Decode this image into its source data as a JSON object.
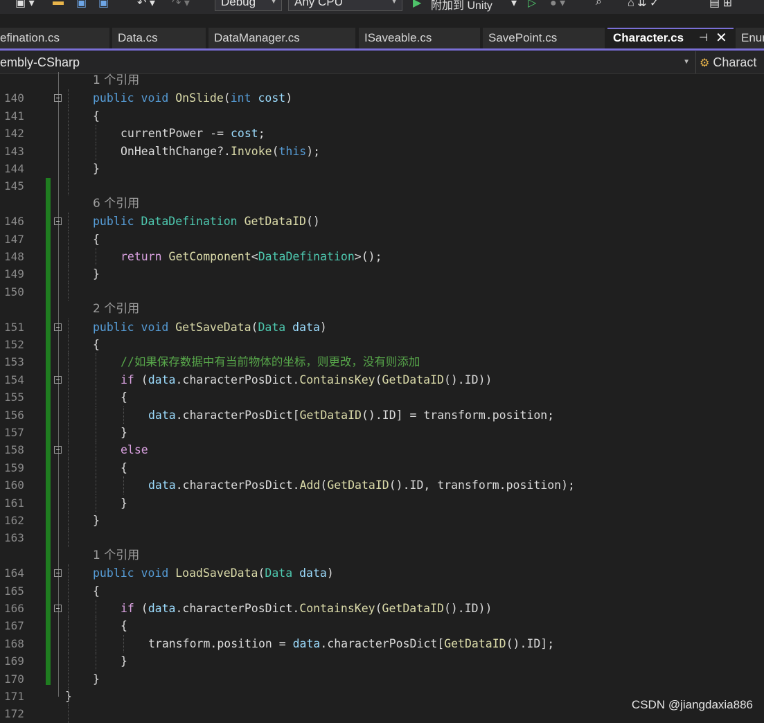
{
  "toolbar": {
    "config": "Debug",
    "platform": "Any CPU",
    "run_label": "附加到 Unity"
  },
  "tabs": [
    {
      "label": "efination.cs"
    },
    {
      "label": "Data.cs"
    },
    {
      "label": "DataManager.cs"
    },
    {
      "label": "ISaveable.cs"
    },
    {
      "label": "SavePoint.cs"
    },
    {
      "label": "Character.cs",
      "active": true
    },
    {
      "label": "Enum"
    }
  ],
  "nav": {
    "project": "embly-CSharp",
    "member": "Charact"
  },
  "colors": {
    "background": "#1f1f1f",
    "keyword": "#569cd6",
    "control": "#d8a0df",
    "type": "#4ec9b0",
    "method": "#dcdcaa",
    "param": "#9cdcfe",
    "comment": "#57a64a",
    "accent": "#7a6fd6",
    "changebar": "#1f7d20"
  },
  "code": {
    "lines": [
      {
        "ref": "1 个引用"
      },
      {
        "n": "140",
        "indent": 0,
        "fold": true,
        "t": [
          [
            "kw",
            "public"
          ],
          [
            "pl",
            " "
          ],
          [
            "kw",
            "void"
          ],
          [
            "pl",
            " "
          ],
          [
            "fn",
            "OnSlide"
          ],
          [
            "pl",
            "("
          ],
          [
            "kw",
            "int"
          ],
          [
            "pl",
            " "
          ],
          [
            "pm",
            "cost"
          ],
          [
            "pl",
            ")"
          ]
        ]
      },
      {
        "n": "141",
        "indent": 0,
        "t": [
          [
            "pl",
            "{"
          ]
        ]
      },
      {
        "n": "142",
        "indent": 1,
        "t": [
          [
            "pl",
            "currentPower -= "
          ],
          [
            "pm",
            "cost"
          ],
          [
            "pl",
            ";"
          ]
        ]
      },
      {
        "n": "143",
        "indent": 1,
        "t": [
          [
            "pl",
            "OnHealthChange?."
          ],
          [
            "fn",
            "Invoke"
          ],
          [
            "pl",
            "("
          ],
          [
            "kw",
            "this"
          ],
          [
            "pl",
            ");"
          ]
        ]
      },
      {
        "n": "144",
        "indent": 0,
        "t": [
          [
            "pl",
            "}"
          ]
        ]
      },
      {
        "n": "145",
        "indent": 0,
        "t": []
      },
      {
        "ref": "6 个引用"
      },
      {
        "n": "146",
        "indent": 0,
        "fold": true,
        "t": [
          [
            "kw",
            "public"
          ],
          [
            "pl",
            " "
          ],
          [
            "ty",
            "DataDefination"
          ],
          [
            "pl",
            " "
          ],
          [
            "fn",
            "GetDataID"
          ],
          [
            "pl",
            "()"
          ]
        ]
      },
      {
        "n": "147",
        "indent": 0,
        "t": [
          [
            "pl",
            "{"
          ]
        ]
      },
      {
        "n": "148",
        "indent": 1,
        "t": [
          [
            "ctl",
            "return"
          ],
          [
            "pl",
            " "
          ],
          [
            "fn",
            "GetComponent"
          ],
          [
            "pl",
            "<"
          ],
          [
            "ty",
            "DataDefination"
          ],
          [
            "pl",
            ">();"
          ]
        ]
      },
      {
        "n": "149",
        "indent": 0,
        "t": [
          [
            "pl",
            "}"
          ]
        ]
      },
      {
        "n": "150",
        "indent": 0,
        "t": []
      },
      {
        "ref": "2 个引用"
      },
      {
        "n": "151",
        "indent": 0,
        "fold": true,
        "t": [
          [
            "kw",
            "public"
          ],
          [
            "pl",
            " "
          ],
          [
            "kw",
            "void"
          ],
          [
            "pl",
            " "
          ],
          [
            "fn",
            "GetSaveData"
          ],
          [
            "pl",
            "("
          ],
          [
            "ty",
            "Data"
          ],
          [
            "pl",
            " "
          ],
          [
            "pm",
            "data"
          ],
          [
            "pl",
            ")"
          ]
        ]
      },
      {
        "n": "152",
        "indent": 0,
        "t": [
          [
            "pl",
            "{"
          ]
        ]
      },
      {
        "n": "153",
        "indent": 1,
        "t": [
          [
            "cm",
            "//如果保存数据中有当前物体的坐标，则更改，没有则添加"
          ]
        ]
      },
      {
        "n": "154",
        "indent": 1,
        "fold": true,
        "t": [
          [
            "ctl",
            "if"
          ],
          [
            "pl",
            " ("
          ],
          [
            "pm",
            "data"
          ],
          [
            "pl",
            ".characterPosDict."
          ],
          [
            "fn",
            "ContainsKey"
          ],
          [
            "pl",
            "("
          ],
          [
            "fn",
            "GetDataID"
          ],
          [
            "pl",
            "().ID))"
          ]
        ]
      },
      {
        "n": "155",
        "indent": 1,
        "t": [
          [
            "pl",
            "{"
          ]
        ]
      },
      {
        "n": "156",
        "indent": 2,
        "t": [
          [
            "pm",
            "data"
          ],
          [
            "pl",
            ".characterPosDict["
          ],
          [
            "fn",
            "GetDataID"
          ],
          [
            "pl",
            "().ID] = transform.position;"
          ]
        ]
      },
      {
        "n": "157",
        "indent": 1,
        "t": [
          [
            "pl",
            "}"
          ]
        ]
      },
      {
        "n": "158",
        "indent": 1,
        "fold": true,
        "t": [
          [
            "ctl",
            "else"
          ]
        ]
      },
      {
        "n": "159",
        "indent": 1,
        "t": [
          [
            "pl",
            "{"
          ]
        ]
      },
      {
        "n": "160",
        "indent": 2,
        "t": [
          [
            "pm",
            "data"
          ],
          [
            "pl",
            ".characterPosDict."
          ],
          [
            "fn",
            "Add"
          ],
          [
            "pl",
            "("
          ],
          [
            "fn",
            "GetDataID"
          ],
          [
            "pl",
            "().ID, transform.position);"
          ]
        ]
      },
      {
        "n": "161",
        "indent": 1,
        "t": [
          [
            "pl",
            "}"
          ]
        ]
      },
      {
        "n": "162",
        "indent": 0,
        "t": [
          [
            "pl",
            "}"
          ]
        ]
      },
      {
        "n": "163",
        "indent": 0,
        "t": []
      },
      {
        "ref": "1 个引用"
      },
      {
        "n": "164",
        "indent": 0,
        "fold": true,
        "t": [
          [
            "kw",
            "public"
          ],
          [
            "pl",
            " "
          ],
          [
            "kw",
            "void"
          ],
          [
            "pl",
            " "
          ],
          [
            "fn",
            "LoadSaveData"
          ],
          [
            "pl",
            "("
          ],
          [
            "ty",
            "Data"
          ],
          [
            "pl",
            " "
          ],
          [
            "pm",
            "data"
          ],
          [
            "pl",
            ")"
          ]
        ]
      },
      {
        "n": "165",
        "indent": 0,
        "t": [
          [
            "pl",
            "{"
          ]
        ]
      },
      {
        "n": "166",
        "indent": 1,
        "fold": true,
        "t": [
          [
            "ctl",
            "if"
          ],
          [
            "pl",
            " ("
          ],
          [
            "pm",
            "data"
          ],
          [
            "pl",
            ".characterPosDict."
          ],
          [
            "fn",
            "ContainsKey"
          ],
          [
            "pl",
            "("
          ],
          [
            "fn",
            "GetDataID"
          ],
          [
            "pl",
            "().ID))"
          ]
        ]
      },
      {
        "n": "167",
        "indent": 1,
        "t": [
          [
            "pl",
            "{"
          ]
        ]
      },
      {
        "n": "168",
        "indent": 2,
        "t": [
          [
            "pl",
            "transform.position = "
          ],
          [
            "pm",
            "data"
          ],
          [
            "pl",
            ".characterPosDict["
          ],
          [
            "fn",
            "GetDataID"
          ],
          [
            "pl",
            "().ID];"
          ]
        ]
      },
      {
        "n": "169",
        "indent": 1,
        "t": [
          [
            "pl",
            "}"
          ]
        ]
      },
      {
        "n": "170",
        "indent": 0,
        "t": [
          [
            "pl",
            "}"
          ]
        ]
      },
      {
        "n": "171",
        "indent": -1,
        "t": [
          [
            "pl",
            "}"
          ]
        ]
      },
      {
        "n": "172",
        "indent": 0,
        "t": []
      }
    ]
  },
  "watermark": "CSDN @jiangdaxia886"
}
